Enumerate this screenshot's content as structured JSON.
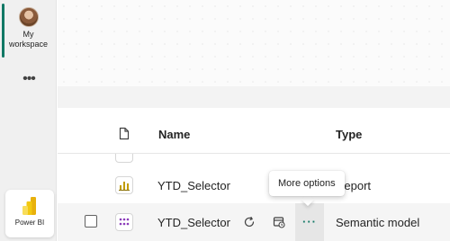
{
  "nav": {
    "workspace_label": "My workspace",
    "more_label": "•••",
    "app_label": "Power BI"
  },
  "table": {
    "columns": {
      "name": "Name",
      "type": "Type"
    },
    "rows": [
      {
        "name": "YTD_Selector",
        "type": "Report",
        "icon": "report-icon"
      },
      {
        "name": "YTD_Selector",
        "type": "Semantic model",
        "icon": "semantic-model-icon"
      }
    ]
  },
  "actions": {
    "more": "···"
  },
  "tooltip": {
    "text": "More options"
  },
  "colors": {
    "accent": "#117865",
    "pbi_yellow": "#F2C811"
  }
}
